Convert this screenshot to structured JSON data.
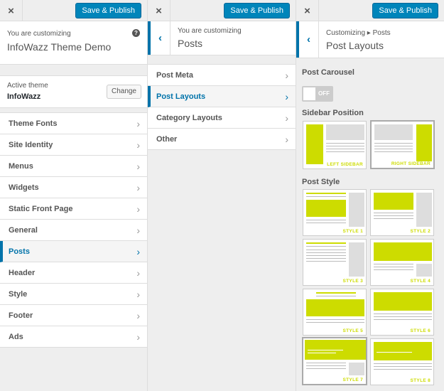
{
  "publish_label": "Save & Publish",
  "close_icon": "×",
  "back_icon": "‹",
  "panel1": {
    "customizing_label": "You are customizing",
    "site_name": "InfoWazz Theme Demo",
    "active_theme_label": "Active theme",
    "active_theme_name": "InfoWazz",
    "change_label": "Change",
    "items": [
      "Theme Fonts",
      "Site Identity",
      "Menus",
      "Widgets",
      "Static Front Page",
      "General",
      "Posts",
      "Header",
      "Style",
      "Footer",
      "Ads"
    ]
  },
  "panel2": {
    "customizing_label": "You are customizing",
    "title": "Posts",
    "items": [
      "Post Meta",
      "Post Layouts",
      "Category Layouts",
      "Other"
    ]
  },
  "panel3": {
    "breadcrumb": "Customizing ▸ Posts",
    "title": "Post Layouts",
    "post_carousel_label": "Post Carousel",
    "carousel_toggle": "OFF",
    "sidebar_position_label": "Sidebar Position",
    "sidebar_options": [
      "LEFT SIDEBAR",
      "RIGHT SIDEBAR"
    ],
    "post_style_label": "Post Style",
    "styles": [
      "STYLE 1",
      "STYLE 2",
      "STYLE 3",
      "STYLE 4",
      "STYLE 5",
      "STYLE 6",
      "STYLE 7",
      "STYLE 8"
    ]
  },
  "colors": {
    "accent": "#0073aa",
    "button": "#0085ba",
    "lime": "#cddc00"
  }
}
